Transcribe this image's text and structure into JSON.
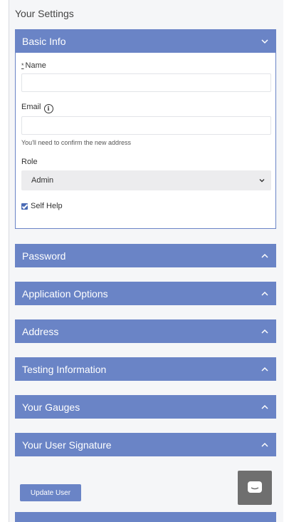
{
  "page": {
    "title": "Your Settings"
  },
  "basic_info": {
    "header": "Basic Info",
    "name_required_mark": "*",
    "name_label": "Name",
    "name_value": "",
    "email_label": "Email",
    "email_value": "",
    "email_hint": "You'll need to confirm the new address",
    "role_label": "Role",
    "role_value": "Admin",
    "self_help_label": "Self Help",
    "self_help_checked": true
  },
  "panels": [
    {
      "label": "Password"
    },
    {
      "label": "Application Options"
    },
    {
      "label": "Address"
    },
    {
      "label": "Testing Information"
    },
    {
      "label": "Your Gauges"
    },
    {
      "label": "Your User Signature"
    }
  ],
  "actions": {
    "update_label": "Update User"
  },
  "icons": {
    "panel_chevron": "chevron-icon",
    "email_info": "info-icon",
    "chat": "chat-icon"
  },
  "colors": {
    "accent": "#6a84c6",
    "checkbox": "#4a6bb5",
    "chat_button": "#6f6f6f"
  }
}
